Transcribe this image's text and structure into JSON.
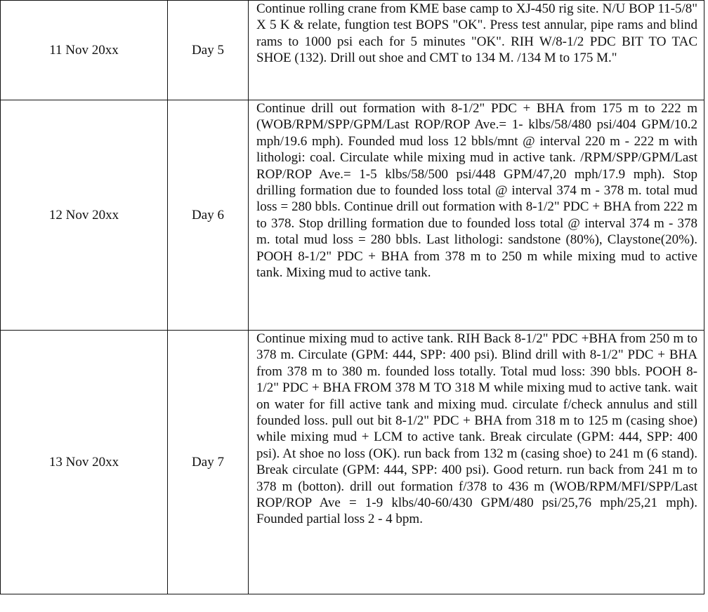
{
  "rows": [
    {
      "date": "11 Nov 20xx",
      "day": "Day 5",
      "activity": "Continue rolling crane from KME base camp to XJ-450 rig site. N/U BOP 11-5/8\" X 5 K & relate, fungtion test BOPS \"OK\". Press test annular, pipe rams and blind rams to 1000 psi each for 5 minutes \"OK\". RIH W/8-1/2 PDC BIT TO TAC SHOE (132). Drill out shoe and CMT to 134 M. /134 M to 175 M.\""
    },
    {
      "date": "12 Nov 20xx",
      "day": "Day 6",
      "activity": "Continue drill out formation with 8-1/2\" PDC + BHA from 175 m to 222 m (WOB/RPM/SPP/GPM/Last ROP/ROP Ave.= 1- klbs/58/480 psi/404 GPM/10.2 mph/19.6 mph). Founded mud loss 12 bbls/mnt @ interval 220 m - 222 m with lithologi: coal. Circulate while mixing mud in active tank. /RPM/SPP/GPM/Last ROP/ROP Ave.= 1-5 klbs/58/500 psi/448 GPM/47,20 mph/17.9 mph). Stop drilling formation due to founded loss total @ interval 374 m - 378 m. total mud loss = 280 bbls. Continue drill out formation with 8-1/2\" PDC + BHA from 222 m to 378. Stop drilling formation due to founded loss total @ interval 374 m - 378 m. total mud loss = 280 bbls. Last lithologi: sandstone (80%), Claystone(20%). POOH 8-1/2\" PDC + BHA from 378 m to 250 m while mixing mud to active tank. Mixing mud to active tank."
    },
    {
      "date": "13 Nov 20xx",
      "day": "Day 7",
      "activity": "Continue mixing mud to active tank. RIH Back 8-1/2\" PDC +BHA from 250 m to 378 m.  Circulate (GPM: 444, SPP: 400 psi). Blind drill with 8-1/2\" PDC + BHA from 378 m to 380 m. founded loss totally. Total mud loss: 390 bbls. POOH 8-1/2\" PDC + BHA FROM 378 M TO 318 M while mixing mud to active tank. wait on water for fill active tank and mixing mud. circulate f/check annulus and still founded loss. pull out bit 8-1/2\" PDC + BHA from 318 m to 125 m (casing shoe) while mixing mud + LCM to active tank. Break circulate (GPM: 444, SPP: 400 psi). At shoe no loss (OK). run back from 132 m (casing shoe) to 241 m (6 stand). Break circulate (GPM: 444, SPP: 400 psi). Good return. run back from 241 m to 378 m (botton). drill out formation f/378 to 436 m (WOB/RPM/MFI/SPP/Last ROP/ROP Ave = 1-9 klbs/40-60/430 GPM/480 psi/25,76 mph/25,21 mph). Founded partial loss 2 - 4 bpm."
    }
  ]
}
